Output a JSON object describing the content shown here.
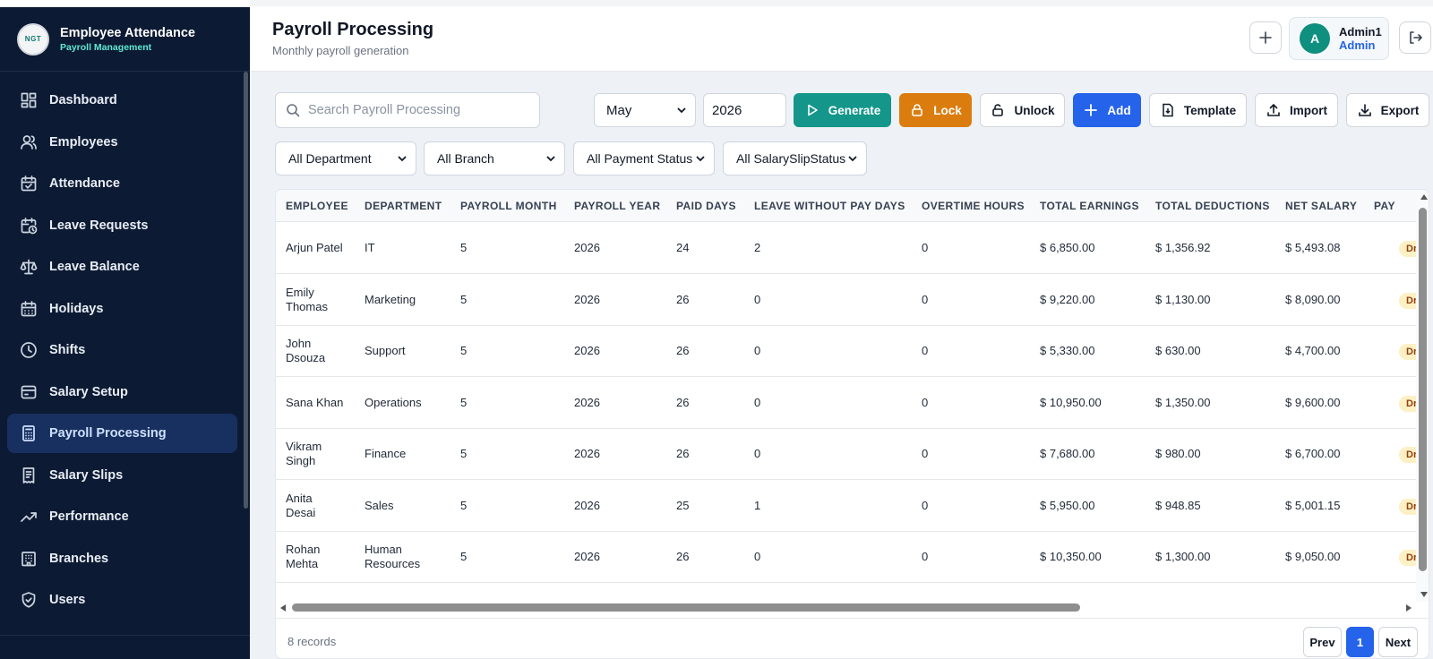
{
  "brand": {
    "logo": "NGT",
    "title": "Employee Attendance",
    "subtitle": "Payroll Management"
  },
  "nav": [
    {
      "label": "Dashboard",
      "icon": "dashboard-icon"
    },
    {
      "label": "Employees",
      "icon": "users-icon"
    },
    {
      "label": "Attendance",
      "icon": "calendar-check-icon"
    },
    {
      "label": "Leave Requests",
      "icon": "calendar-clock-icon"
    },
    {
      "label": "Leave Balance",
      "icon": "scale-icon"
    },
    {
      "label": "Holidays",
      "icon": "calendar-icon"
    },
    {
      "label": "Shifts",
      "icon": "clock-icon"
    },
    {
      "label": "Salary Setup",
      "icon": "wallet-icon"
    },
    {
      "label": "Payroll Processing",
      "icon": "calculator-icon",
      "active": true
    },
    {
      "label": "Salary Slips",
      "icon": "receipt-icon"
    },
    {
      "label": "Performance",
      "icon": "trending-up-icon"
    },
    {
      "label": "Branches",
      "icon": "building-icon"
    },
    {
      "label": "Users",
      "icon": "shield-icon"
    }
  ],
  "header": {
    "title": "Payroll Processing",
    "subtitle": "Monthly payroll generation"
  },
  "user": {
    "initial": "A",
    "name": "Admin1",
    "role": "Admin"
  },
  "toolbar": {
    "search_placeholder": "Search Payroll Processing",
    "month": "May",
    "year": "2026",
    "generate": "Generate",
    "lock": "Lock",
    "unlock": "Unlock",
    "add": "Add",
    "template": "Template",
    "import": "Import",
    "export": "Export"
  },
  "filters": {
    "department": "All Department",
    "branch": "All Branch",
    "payment_status": "All Payment Status",
    "slip_status": "All SalarySlipStatus"
  },
  "table": {
    "columns": [
      "EMPLOYEE",
      "DEPARTMENT",
      "PAYROLL MONTH",
      "PAYROLL YEAR",
      "PAID DAYS",
      "LEAVE WITHOUT PAY DAYS",
      "OVERTIME HOURS",
      "TOTAL EARNINGS",
      "TOTAL DEDUCTIONS",
      "NET SALARY",
      "PAY"
    ],
    "rows": [
      {
        "employee": [
          "Arjun Patel"
        ],
        "department": [
          "IT"
        ],
        "month": "5",
        "year": "2026",
        "paid_days": "24",
        "lwp_days": "2",
        "overtime": "0",
        "earnings": "$ 6,850.00",
        "deductions": "$ 1,356.92",
        "net": "$ 5,493.08",
        "status": "Dr"
      },
      {
        "employee": [
          "Emily",
          "Thomas"
        ],
        "department": [
          "Marketing"
        ],
        "month": "5",
        "year": "2026",
        "paid_days": "26",
        "lwp_days": "0",
        "overtime": "0",
        "earnings": "$ 9,220.00",
        "deductions": "$ 1,130.00",
        "net": "$ 8,090.00",
        "status": "Dr"
      },
      {
        "employee": [
          "John",
          "Dsouza"
        ],
        "department": [
          "Support"
        ],
        "month": "5",
        "year": "2026",
        "paid_days": "26",
        "lwp_days": "0",
        "overtime": "0",
        "earnings": "$ 5,330.00",
        "deductions": "$ 630.00",
        "net": "$ 4,700.00",
        "status": "Dr"
      },
      {
        "employee": [
          "Sana Khan"
        ],
        "department": [
          "Operations"
        ],
        "month": "5",
        "year": "2026",
        "paid_days": "26",
        "lwp_days": "0",
        "overtime": "0",
        "earnings": "$ 10,950.00",
        "deductions": "$ 1,350.00",
        "net": "$ 9,600.00",
        "status": "Dr"
      },
      {
        "employee": [
          "Vikram",
          "Singh"
        ],
        "department": [
          "Finance"
        ],
        "month": "5",
        "year": "2026",
        "paid_days": "26",
        "lwp_days": "0",
        "overtime": "0",
        "earnings": "$ 7,680.00",
        "deductions": "$ 980.00",
        "net": "$ 6,700.00",
        "status": "Dr"
      },
      {
        "employee": [
          "Anita",
          "Desai"
        ],
        "department": [
          "Sales"
        ],
        "month": "5",
        "year": "2026",
        "paid_days": "25",
        "lwp_days": "1",
        "overtime": "0",
        "earnings": "$ 5,950.00",
        "deductions": "$ 948.85",
        "net": "$ 5,001.15",
        "status": "Dr"
      },
      {
        "employee": [
          "Rohan",
          "Mehta"
        ],
        "department": [
          "Human",
          "Resources"
        ],
        "month": "5",
        "year": "2026",
        "paid_days": "26",
        "lwp_days": "0",
        "overtime": "0",
        "earnings": "$ 10,350.00",
        "deductions": "$ 1,300.00",
        "net": "$ 9,050.00",
        "status": "Dr"
      }
    ]
  },
  "footer": {
    "records": "8 records",
    "prev": "Prev",
    "page": "1",
    "next": "Next"
  },
  "colors": {
    "sidebar": "#0c1a33",
    "active_nav": "#17305f",
    "teal": "#14968a",
    "orange": "#db7d0e",
    "blue": "#2563eb",
    "badge": "#fdf0c4"
  }
}
